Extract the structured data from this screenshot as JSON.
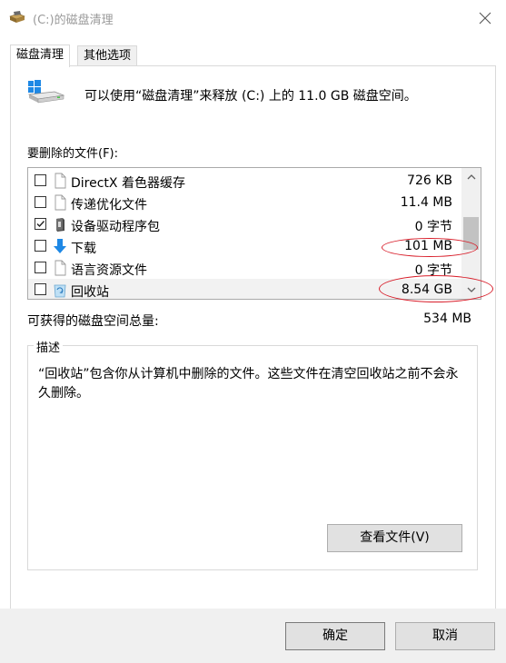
{
  "window": {
    "title": "(C:)的磁盘清理"
  },
  "tabs": [
    {
      "label": "磁盘清理",
      "active": true
    },
    {
      "label": "其他选项",
      "active": false
    }
  ],
  "summary": "可以使用“磁盘清理”来释放 (C:) 上的 11.0 GB 磁盘空间。",
  "files_label": "要删除的文件(F):",
  "files": [
    {
      "name": "DirectX 着色器缓存",
      "size": "726 KB",
      "checked": false,
      "icon": "blank-file-icon"
    },
    {
      "name": "传递优化文件",
      "size": "11.4 MB",
      "checked": false,
      "icon": "blank-file-icon"
    },
    {
      "name": "设备驱动程序包",
      "size": "0 字节",
      "checked": true,
      "icon": "driver-package-icon"
    },
    {
      "name": "下载",
      "size": "101 MB",
      "checked": false,
      "icon": "download-arrow-icon"
    },
    {
      "name": "语言资源文件",
      "size": "0 字节",
      "checked": false,
      "icon": "blank-file-icon"
    },
    {
      "name": "回收站",
      "size": "8.54 GB",
      "checked": false,
      "icon": "recycle-bin-icon"
    }
  ],
  "total": {
    "label": "可获得的磁盘空间总量:",
    "value": "534 MB"
  },
  "description": {
    "legend": "描述",
    "text": "“回收站”包含你从计算机中删除的文件。这些文件在清空回收站之前不会永久删除。",
    "view_button": "查看文件(V)"
  },
  "buttons": {
    "ok": "确定",
    "cancel": "取消"
  },
  "colors": {
    "annotation_red": "#d81e2a",
    "accent_blue": "#1e88e5"
  }
}
